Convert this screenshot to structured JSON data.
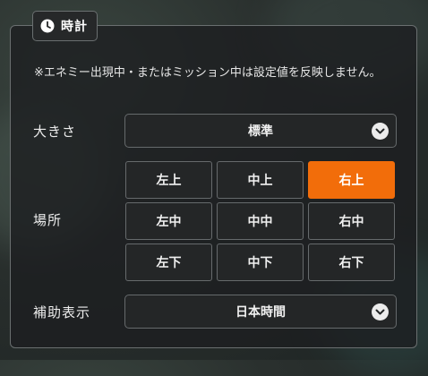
{
  "panel": {
    "title": "時計",
    "notice": "※エネミー出現中・またはミッション中は設定値を反映しません。"
  },
  "size": {
    "label": "大きさ",
    "selected": "標準"
  },
  "position": {
    "label": "場所",
    "selected": "右上",
    "options": [
      [
        "左上",
        "中上",
        "右上"
      ],
      [
        "左中",
        "中中",
        "右中"
      ],
      [
        "左下",
        "中下",
        "右下"
      ]
    ]
  },
  "aux": {
    "label": "補助表示",
    "selected": "日本時間"
  },
  "icons": {
    "title": "clock-icon",
    "dropdown": "chevron-down-icon"
  },
  "colors": {
    "accent": "#f26d0a",
    "panel_border": "#6a6f70",
    "button_bg": "#242627"
  }
}
